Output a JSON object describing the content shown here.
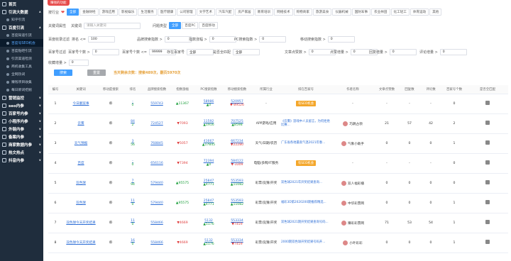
{
  "sidebar": {
    "items": [
      {
        "label": "首页",
        "type": "grp",
        "arrow": ""
      },
      {
        "label": "引流大数据",
        "type": "grp",
        "arrow": "∧"
      },
      {
        "label": "知乎引流",
        "type": "sub",
        "arrow": ""
      },
      {
        "label": "百度引流",
        "type": "grp",
        "arrow": "∧"
      },
      {
        "label": "百度知道引流",
        "type": "sub",
        "arrow": ""
      },
      {
        "label": "百度号SEO机会",
        "type": "sub active",
        "arrow": ""
      },
      {
        "label": "百度贴吧引流",
        "type": "sub",
        "arrow": ""
      },
      {
        "label": "引流渠道检测",
        "type": "sub",
        "arrow": ""
      },
      {
        "label": "商机收集工具",
        "type": "sub",
        "arrow": ""
      },
      {
        "label": "全网热词",
        "type": "sub",
        "arrow": ""
      },
      {
        "label": "赚钱项目收集",
        "type": "sub",
        "arrow": ""
      },
      {
        "label": "每日新词挖掘",
        "type": "sub",
        "arrow": ""
      },
      {
        "label": "营销监控",
        "type": "grp",
        "arrow": "∨"
      },
      {
        "label": "seo内参",
        "type": "grp",
        "arrow": "∨"
      },
      {
        "label": "百家号内参",
        "type": "grp",
        "arrow": "∨"
      },
      {
        "label": "小程序内参",
        "type": "grp",
        "arrow": "∨"
      },
      {
        "label": "外链内参",
        "type": "grp",
        "arrow": "∨"
      },
      {
        "label": "备案内参",
        "type": "grp",
        "arrow": "∨"
      },
      {
        "label": "商家数据内参",
        "type": "grp",
        "arrow": "∨"
      },
      {
        "label": "热文热点",
        "type": "grp",
        "arrow": "∨"
      },
      {
        "label": "抖音内参",
        "type": "grp",
        "arrow": "∨"
      }
    ]
  },
  "top_badge": "赚钱的功能",
  "filter": {
    "industry_label": "按行业",
    "industries": [
      "全部",
      "金融财经",
      "游戏应用",
      "影视娱乐",
      "生活服务",
      "医疗健康",
      "公司管理",
      "文学艺术",
      "汽车汽配",
      "房产家居",
      "教育培训",
      "网络技术",
      "购物商家",
      "旅游美食",
      "仪器机械",
      "国防军事",
      "农业林田",
      "化工轻工",
      "体育运动",
      "其他"
    ],
    "keyword_attr_label": "关键词属性",
    "keyword_label": "关键词",
    "keyword_placeholder": "请输入关键词",
    "search_type_label": "问题类型",
    "search_types": [
      "全部",
      "百度PC",
      "百度移动"
    ],
    "row3": [
      {
        "label": "百度收录过滤",
        "sub": "排名 <=",
        "value": "100"
      },
      {
        "label": "",
        "sub": "品牌搜索指数 >",
        "value": "0"
      },
      {
        "label": "",
        "sub": "指数涨幅 >",
        "value": "0"
      },
      {
        "label": "",
        "sub": "PC搜索指数 >",
        "value": "0"
      },
      {
        "label": "",
        "sub": "移动搜索指数 >",
        "value": "0"
      }
    ],
    "row4": [
      {
        "label": "百家号过滤",
        "sub": "百家号个数 >",
        "value": "0"
      },
      {
        "label": "",
        "sub": "百家号个数 <=",
        "value": "99999"
      },
      {
        "label": "",
        "sub": "存在百家号",
        "value": "全部"
      },
      {
        "label": "",
        "sub": "是否全匹配",
        "value": "全部"
      },
      {
        "label": "",
        "sub": "文章点赞数 >",
        "value": "0"
      },
      {
        "label": "",
        "sub": "点赞增量 >",
        "value": "0"
      },
      {
        "label": "",
        "sub": "回复增量 >",
        "value": "0"
      },
      {
        "label": "",
        "sub": "评论增量 >",
        "value": "0"
      }
    ],
    "row5": {
      "sub": "收藏增量 >",
      "value": "0"
    },
    "search_btn": "搜索",
    "reset_btn": "重置",
    "note": "当天剩余次数：搜索489次，翻页5970次"
  },
  "table": {
    "headers": [
      "编号",
      "关键词",
      "移动度搜索",
      "排名",
      "品牌搜索指数",
      "指数涨幅",
      "PC搜索指数",
      "移动搜索指数",
      "所属行业",
      "排在百家号",
      "作者名称",
      "文章点赞数",
      "回复数",
      "评论数",
      "百家号个数",
      "是否全匹配"
    ],
    "rows": [
      {
        "no": "1",
        "kw": "今日翻案事",
        "rank": "-",
        "rank2": "0",
        "brand": "559743",
        "chg": "11367",
        "chg_dir": "up",
        "pc": "58986",
        "pc2": "0",
        "mob": "520957",
        "mob2": "-89526",
        "mob_dir": "dn",
        "ind": "-",
        "bjh": "",
        "bjh_tag": "有SEO机会",
        "author": "-",
        "likes": "-",
        "r1": "-",
        "r2": "-",
        "cnt": "0"
      },
      {
        "no": "2",
        "kw": "云雾",
        "rank": "84",
        "rank2": "2",
        "brand": "724527",
        "chg": "7093",
        "chg_dir": "dn",
        "pc": "11592",
        "pc2": "1916",
        "mob": "707525",
        "mob2": "8598",
        "mob_dir": "up",
        "ind": "APP游戏/应用",
        "bjh": "《云雾》游戏中人员留言，为何拒绝比赛...",
        "bjh_tag": "",
        "author": "巧跳占领",
        "likes": "21",
        "r1": "57",
        "r2": "42",
        "cnt": "2"
      },
      {
        "no": "3",
        "kw": "天气预报",
        "rank": "3",
        "rank2": "56",
        "brand": "768845",
        "chg": "5057",
        "chg_dir": "dn",
        "pc": "41667",
        "pc2": "17845",
        "mob": "667234",
        "mob2": "22280",
        "mob_dir": "dn",
        "ind": "天气/日期/农历",
        "bjh": "广东省各地最高气温2021年春...",
        "bjh_tag": "",
        "author": "气象小助手",
        "likes": "0",
        "r1": "0",
        "r2": "0",
        "cnt": "1"
      },
      {
        "no": "4",
        "kw": "百度",
        "rank": "-",
        "rank2": "0",
        "brand": "656116",
        "chg": "7394",
        "chg_dir": "dn",
        "pc": "72394",
        "pc2": "0",
        "mob": "584122",
        "mob2": "-3309",
        "mob_dir": "dn",
        "ind": "电脑/多网/IT服务",
        "bjh": "",
        "bjh_tag": "有SEO机会",
        "author": "-",
        "likes": "-",
        "r1": "-",
        "r2": "-",
        "cnt": "0"
      },
      {
        "no": "5",
        "kw": "双色球",
        "rank": "7",
        "rank2": "94",
        "brand": "579440",
        "chg": "95575",
        "chg_dir": "up",
        "pc": "25847",
        "pc2": "4771",
        "mob": "553593",
        "mob2": "11082",
        "mob_dir": "up",
        "ind": "彩票/竞猜/开奖",
        "bjh": "双色球2021年开奖结果查询...",
        "bjh_tag": "",
        "author": "双人福彩播",
        "likes": "0",
        "r1": "0",
        "r2": "0",
        "cnt": "0"
      },
      {
        "no": "6",
        "kw": "双色球",
        "rank": "11",
        "rank2": "0",
        "brand": "579440",
        "chg": "95575",
        "chg_dir": "up",
        "pc": "25847",
        "pc2": "4771",
        "mob": "553593",
        "mob2": "11082",
        "mob_dir": "up",
        "ind": "彩票/竞猜/开奖",
        "bjh": "福彩3D第2020200期推荐精选...",
        "bjh_tag": "",
        "author": "中华彩票网",
        "likes": "0",
        "r1": "0",
        "r2": "0",
        "cnt": "1"
      },
      {
        "no": "7",
        "kw": "双色球今天开奖结果",
        "rank": "11",
        "rank2": "0",
        "brand": "558466",
        "chg": "4669",
        "chg_dir": "dn",
        "pc": "5132",
        "pc2": "5176",
        "mob": "553334",
        "mob2": "7459",
        "mob_dir": "dn",
        "ind": "彩票/竞猜/开奖",
        "bjh": "双色球2021期开奖结果查询号码...",
        "bjh_tag": "",
        "author": "赚彩彩票网",
        "likes": "71",
        "r1": "53",
        "r2": "54",
        "cnt": "1"
      },
      {
        "no": "8",
        "kw": "双色球今天开奖结果",
        "rank": "16",
        "rank2": "0",
        "brand": "558466",
        "chg": "4669",
        "chg_dir": "dn",
        "pc": "5132",
        "pc2": "5176",
        "mob": "553334",
        "mob2": "7459",
        "mob_dir": "dn",
        "ind": "彩票/竞猜/开奖",
        "bjh": "2000期双色球开奖结果号码开...",
        "bjh_tag": "",
        "author": "小叶彩彩",
        "likes": "0",
        "r1": "0",
        "r2": "0",
        "cnt": "1"
      }
    ]
  }
}
